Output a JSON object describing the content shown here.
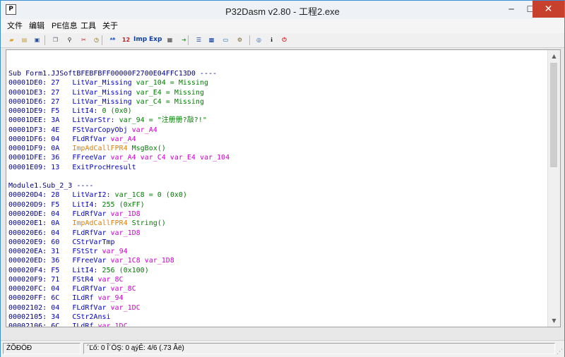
{
  "window": {
    "title": "P32Dasm v2.80 - 工程2.exe",
    "icon_letter": "P",
    "minimize_glyph": "─",
    "maximize_glyph": "☐",
    "close_glyph": "✕"
  },
  "menu": [
    "文件",
    "编辑",
    "PE信息",
    "工具",
    "关于"
  ],
  "toolbar_icons": [
    {
      "name": "open-folder-icon",
      "glyph": "▰",
      "color": "#d9a020"
    },
    {
      "name": "copy-file-icon",
      "glyph": "▤",
      "color": "#c8a030"
    },
    {
      "name": "save-disk-icon",
      "glyph": "▣",
      "color": "#1c4fa8"
    },
    {
      "name": "copy-icon",
      "glyph": "❐",
      "color": "#505080"
    },
    {
      "name": "find-binoculars-icon",
      "glyph": "⚲",
      "color": "#202020"
    },
    {
      "name": "cut-icon",
      "glyph": "✂",
      "color": "#c02020"
    },
    {
      "name": "clock-icon",
      "glyph": "◷",
      "color": "#806000"
    },
    {
      "name": "abc-icon",
      "glyph": "ᴬᴮ",
      "color": "#1040c0"
    },
    {
      "name": "numbers-icon",
      "glyph": "12",
      "color": "#c02020"
    },
    {
      "name": "imp-icon",
      "glyph": "Imp",
      "color": "#1040a0"
    },
    {
      "name": "exp-icon",
      "glyph": "Exp",
      "color": "#1040a0"
    },
    {
      "name": "table-icon",
      "glyph": "▦",
      "color": "#404040"
    },
    {
      "name": "goto-icon",
      "glyph": "➜",
      "color": "#30a030"
    },
    {
      "name": "list-icon",
      "glyph": "☰",
      "color": "#1040a0"
    },
    {
      "name": "grid-icon",
      "glyph": "▩",
      "color": "#1040a0"
    },
    {
      "name": "window-icon",
      "glyph": "▭",
      "color": "#1060a0"
    },
    {
      "name": "tools-icon",
      "glyph": "⚙",
      "color": "#806000"
    },
    {
      "name": "web-icon",
      "glyph": "◎",
      "color": "#2060c0"
    },
    {
      "name": "info-icon",
      "glyph": "ℹ",
      "color": "#1a1a1a"
    },
    {
      "name": "exit-icon",
      "glyph": "⏻",
      "color": "#d02020"
    }
  ],
  "code_lines": [
    [
      {
        "t": "Sub Form1.JJSoftBFEBFBFF00000F2700E04FFC13D0 ----",
        "c": "head"
      }
    ],
    [
      {
        "t": "00001DE0: ",
        "c": "addr"
      },
      {
        "t": "27   ",
        "c": "op"
      },
      {
        "t": "LitVar_Missing ",
        "c": "mn"
      },
      {
        "t": "var_104 = Missing",
        "c": "grn"
      }
    ],
    [
      {
        "t": "00001DE3: ",
        "c": "addr"
      },
      {
        "t": "27   ",
        "c": "op"
      },
      {
        "t": "LitVar_Missing ",
        "c": "mn"
      },
      {
        "t": "var_E4 = Missing",
        "c": "grn"
      }
    ],
    [
      {
        "t": "00001DE6: ",
        "c": "addr"
      },
      {
        "t": "27   ",
        "c": "op"
      },
      {
        "t": "LitVar_Missing ",
        "c": "mn"
      },
      {
        "t": "var_C4 = Missing",
        "c": "grn"
      }
    ],
    [
      {
        "t": "00001DE9: ",
        "c": "addr"
      },
      {
        "t": "F5   ",
        "c": "op"
      },
      {
        "t": "LitI4: ",
        "c": "mn"
      },
      {
        "t": "0 (0x0)",
        "c": "grn"
      }
    ],
    [
      {
        "t": "00001DEE: ",
        "c": "addr"
      },
      {
        "t": "3A   ",
        "c": "op"
      },
      {
        "t": "LitVarStr: ",
        "c": "mn"
      },
      {
        "t": "var_94 = \"注册册?敲?!\"",
        "c": "grn"
      }
    ],
    [
      {
        "t": "00001DF3: ",
        "c": "addr"
      },
      {
        "t": "4E   ",
        "c": "op"
      },
      {
        "t": "FStVarCopyObj ",
        "c": "mn"
      },
      {
        "t": "var_A4",
        "c": "var"
      }
    ],
    [
      {
        "t": "00001DF6: ",
        "c": "addr"
      },
      {
        "t": "04   ",
        "c": "op"
      },
      {
        "t": "FLdRfVar ",
        "c": "mn"
      },
      {
        "t": "var_A4",
        "c": "var"
      }
    ],
    [
      {
        "t": "00001DF9: ",
        "c": "addr"
      },
      {
        "t": "0A   ",
        "c": "op"
      },
      {
        "t": "ImpAdCallFPR4 ",
        "c": "org"
      },
      {
        "t": "MsgBox()",
        "c": "grn"
      }
    ],
    [
      {
        "t": "00001DFE: ",
        "c": "addr"
      },
      {
        "t": "36   ",
        "c": "op"
      },
      {
        "t": "FFreeVar ",
        "c": "mn"
      },
      {
        "t": "var_A4 var_C4 var_E4 var_104",
        "c": "var"
      }
    ],
    [
      {
        "t": "00001E09: ",
        "c": "addr"
      },
      {
        "t": "13   ",
        "c": "op"
      },
      {
        "t": "ExitProcHresult",
        "c": "mn"
      }
    ],
    [
      {
        "t": "",
        "c": "blk"
      }
    ],
    [
      {
        "t": "Module1.Sub_2_3 ----",
        "c": "head"
      }
    ],
    [
      {
        "t": "000020D4: ",
        "c": "addr"
      },
      {
        "t": "28   ",
        "c": "op"
      },
      {
        "t": "LitVarI2: ",
        "c": "mn"
      },
      {
        "t": "var_1C8 = 0 (0x0)",
        "c": "grn"
      }
    ],
    [
      {
        "t": "000020D9: ",
        "c": "addr"
      },
      {
        "t": "F5   ",
        "c": "op"
      },
      {
        "t": "LitI4: ",
        "c": "mn"
      },
      {
        "t": "255 (0xFF)",
        "c": "grn"
      }
    ],
    [
      {
        "t": "000020DE: ",
        "c": "addr"
      },
      {
        "t": "04   ",
        "c": "op"
      },
      {
        "t": "FLdRfVar ",
        "c": "mn"
      },
      {
        "t": "var_1D8",
        "c": "var"
      }
    ],
    [
      {
        "t": "000020E1: ",
        "c": "addr"
      },
      {
        "t": "0A   ",
        "c": "op"
      },
      {
        "t": "ImpAdCallFPR4 ",
        "c": "org"
      },
      {
        "t": "String()",
        "c": "grn"
      }
    ],
    [
      {
        "t": "000020E6: ",
        "c": "addr"
      },
      {
        "t": "04   ",
        "c": "op"
      },
      {
        "t": "FLdRfVar ",
        "c": "mn"
      },
      {
        "t": "var_1D8",
        "c": "var"
      }
    ],
    [
      {
        "t": "000020E9: ",
        "c": "addr"
      },
      {
        "t": "60   ",
        "c": "op"
      },
      {
        "t": "CStrVarTmp",
        "c": "mn"
      }
    ],
    [
      {
        "t": "000020EA: ",
        "c": "addr"
      },
      {
        "t": "31   ",
        "c": "op"
      },
      {
        "t": "FStStr ",
        "c": "mn"
      },
      {
        "t": "var_94",
        "c": "var"
      }
    ],
    [
      {
        "t": "000020ED: ",
        "c": "addr"
      },
      {
        "t": "36   ",
        "c": "op"
      },
      {
        "t": "FFreeVar ",
        "c": "mn"
      },
      {
        "t": "var_1C8 var_1D8",
        "c": "var"
      }
    ],
    [
      {
        "t": "000020F4: ",
        "c": "addr"
      },
      {
        "t": "F5   ",
        "c": "op"
      },
      {
        "t": "LitI4: ",
        "c": "mn"
      },
      {
        "t": "256 (0x100)",
        "c": "grn"
      }
    ],
    [
      {
        "t": "000020F9: ",
        "c": "addr"
      },
      {
        "t": "71   ",
        "c": "op"
      },
      {
        "t": "FStR4 ",
        "c": "mn"
      },
      {
        "t": "var_8C",
        "c": "var"
      }
    ],
    [
      {
        "t": "000020FC: ",
        "c": "addr"
      },
      {
        "t": "04   ",
        "c": "op"
      },
      {
        "t": "FLdRfVar ",
        "c": "mn"
      },
      {
        "t": "var_8C",
        "c": "var"
      }
    ],
    [
      {
        "t": "000020FF: ",
        "c": "addr"
      },
      {
        "t": "6C   ",
        "c": "op"
      },
      {
        "t": "ILdRf ",
        "c": "mn"
      },
      {
        "t": "var_94",
        "c": "var"
      }
    ],
    [
      {
        "t": "00002102: ",
        "c": "addr"
      },
      {
        "t": "04   ",
        "c": "op"
      },
      {
        "t": "FLdRfVar ",
        "c": "mn"
      },
      {
        "t": "var_1DC",
        "c": "var"
      }
    ],
    [
      {
        "t": "00002105: ",
        "c": "addr"
      },
      {
        "t": "34   ",
        "c": "op"
      },
      {
        "t": "CStr2Ansi",
        "c": "mn"
      }
    ],
    [
      {
        "t": "00002106: ",
        "c": "addr"
      },
      {
        "t": "6C   ",
        "c": "op"
      },
      {
        "t": "ILdRf ",
        "c": "mn"
      },
      {
        "t": "var_1DC",
        "c": "var"
      }
    ]
  ],
  "status": {
    "left": "ŻÕĐÖĐ",
    "middle": "´Ľő: 0   Î´ÖŞ: 0   ąýÊ: 4/6  (.73 Ãë)"
  }
}
